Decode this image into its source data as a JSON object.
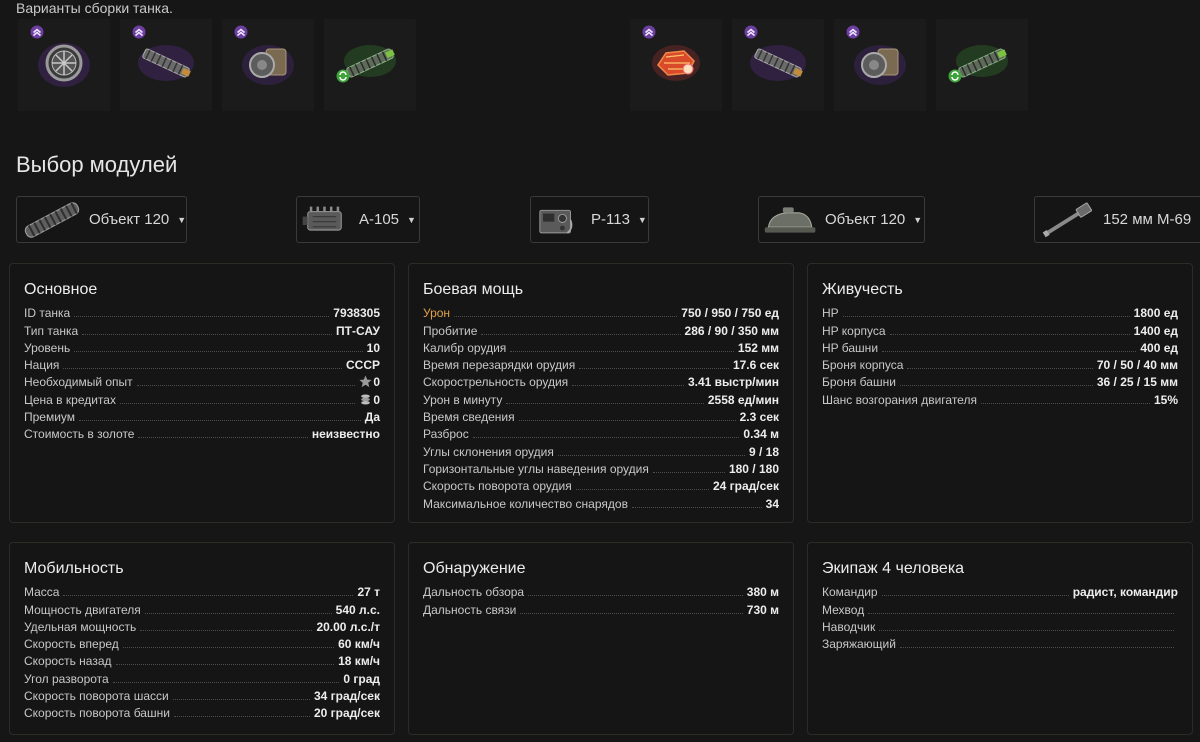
{
  "builds": {
    "title": "Варианты сборки танка.",
    "left_slots": [
      {
        "icon": "ventilation-icon",
        "rank": true,
        "swap": false
      },
      {
        "icon": "rammer-icon",
        "rank": true,
        "swap": false
      },
      {
        "icon": "vertical-stabilizer-icon",
        "rank": true,
        "swap": false
      },
      {
        "icon": "rammer-green-icon",
        "rank": false,
        "swap": true
      }
    ],
    "right_slots": [
      {
        "icon": "improved-hardening-icon",
        "rank": true,
        "swap": false
      },
      {
        "icon": "rammer-icon",
        "rank": true,
        "swap": false
      },
      {
        "icon": "vertical-stabilizer-icon",
        "rank": true,
        "swap": false
      },
      {
        "icon": "rammer-green-icon",
        "rank": false,
        "swap": true
      }
    ]
  },
  "modules": {
    "title": "Выбор модулей",
    "items": [
      {
        "icon": "tracks-icon",
        "label": "Объект 120"
      },
      {
        "icon": "engine-icon",
        "label": "А-105"
      },
      {
        "icon": "radio-icon",
        "label": "Р-113"
      },
      {
        "icon": "turret-icon",
        "label": "Объект 120"
      },
      {
        "icon": "gun-icon",
        "label": "152 мм М-69"
      }
    ]
  },
  "panels": {
    "basic": {
      "title": "Основное",
      "rows": [
        {
          "label": "ID танка",
          "value": "7938305"
        },
        {
          "label": "Тип танка",
          "value": "ПТ-САУ"
        },
        {
          "label": "Уровень",
          "value": "10"
        },
        {
          "label": "Нация",
          "value": "СССР"
        },
        {
          "label": "Необходимый опыт",
          "value": "0",
          "icon": "star-icon"
        },
        {
          "label": "Цена в кредитах",
          "value": "0",
          "icon": "coins-icon"
        },
        {
          "label": "Премиум",
          "value": "Да"
        },
        {
          "label": "Стоимость в золоте",
          "value": "неизвестно"
        }
      ]
    },
    "firepower": {
      "title": "Боевая мощь",
      "rows": [
        {
          "label": "Урон",
          "value": "750 / 950 / 750 ед",
          "accent": true
        },
        {
          "label": "Пробитие",
          "value": "286 / 90 / 350 мм"
        },
        {
          "label": "Калибр орудия",
          "value": "152 мм"
        },
        {
          "label": "Время перезарядки орудия",
          "value": "17.6 сек"
        },
        {
          "label": "Скорострельность орудия",
          "value": "3.41 выстр/мин"
        },
        {
          "label": "Урон в минуту",
          "value": "2558 ед/мин"
        },
        {
          "label": "Время сведения",
          "value": "2.3 сек"
        },
        {
          "label": "Разброс",
          "value": "0.34 м"
        },
        {
          "label": "Углы склонения орудия",
          "value": "9 / 18"
        },
        {
          "label": "Горизонтальные углы наведения орудия",
          "value": "180 / 180"
        },
        {
          "label": "Скорость поворота орудия",
          "value": "24 град/сек"
        },
        {
          "label": "Максимальное количество снарядов",
          "value": "34"
        }
      ]
    },
    "survivability": {
      "title": "Живучесть",
      "rows": [
        {
          "label": "HP",
          "value": "1800 ед"
        },
        {
          "label": "HP корпуса",
          "value": "1400 ед"
        },
        {
          "label": "HP башни",
          "value": "400 ед"
        },
        {
          "label": "Броня корпуса",
          "value": "70 / 50 / 40 мм"
        },
        {
          "label": "Броня башни",
          "value": "36 / 25 / 15 мм"
        },
        {
          "label": "Шанс возгорания двигателя",
          "value": "15%"
        }
      ]
    },
    "mobility": {
      "title": "Мобильность",
      "rows": [
        {
          "label": "Масса",
          "value": "27 т"
        },
        {
          "label": "Мощность двигателя",
          "value": "540 л.с."
        },
        {
          "label": "Удельная мощность",
          "value": "20.00 л.с./т"
        },
        {
          "label": "Скорость вперед",
          "value": "60 км/ч"
        },
        {
          "label": "Скорость назад",
          "value": "18 км/ч"
        },
        {
          "label": "Угол разворота",
          "value": "0 град"
        },
        {
          "label": "Скорость поворота шасси",
          "value": "34 град/сек"
        },
        {
          "label": "Скорость поворота башни",
          "value": "20 град/сек"
        }
      ]
    },
    "detection": {
      "title": "Обнаружение",
      "rows": [
        {
          "label": "Дальность обзора",
          "value": "380 м"
        },
        {
          "label": "Дальность связи",
          "value": "730 м"
        }
      ]
    },
    "crew": {
      "title": "Экипаж 4 человека",
      "rows": [
        {
          "label": "Командир",
          "value": "радист, командир"
        },
        {
          "label": "Мехвод",
          "value": ""
        },
        {
          "label": "Наводчик",
          "value": ""
        },
        {
          "label": "Заряжающий",
          "value": ""
        }
      ]
    }
  }
}
